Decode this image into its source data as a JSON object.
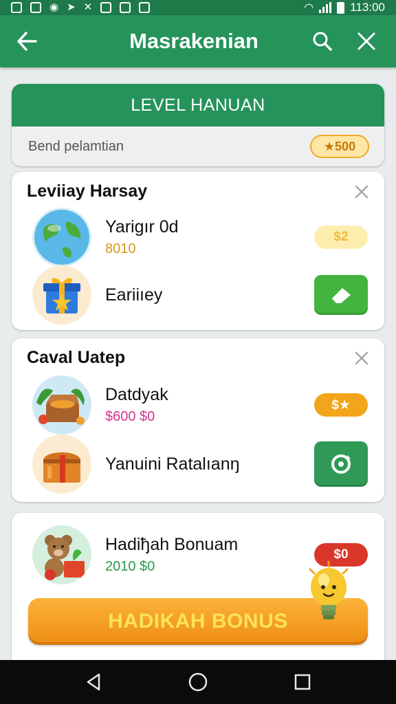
{
  "status_bar": {
    "time": "113:00"
  },
  "app_bar": {
    "title": "Masrakenian"
  },
  "level": {
    "header": "LEVEL HANUAN",
    "label": "Bend pelamtian",
    "points": "★500"
  },
  "cards": [
    {
      "title": "Leviiay Harsay",
      "rows": [
        {
          "name": "Yarigır 0d",
          "sub": "8010",
          "pill": "$2",
          "avatar": "globe-icon"
        },
        {
          "name": "Eariiıey",
          "sub": "",
          "avatar": "gift-box-icon",
          "button": "eraser-icon"
        }
      ]
    },
    {
      "title": "Caval Uatep",
      "rows": [
        {
          "name": "Datdyak",
          "sub": "$600 $0",
          "pill": "$★",
          "avatar": "treasure-chest-icon"
        },
        {
          "name": "Yanuini Ratalıanŋ",
          "sub": "",
          "avatar": "chest-icon",
          "button": "refresh-icon"
        }
      ]
    },
    {
      "title": "",
      "rows": [
        {
          "name": "Hadiђah Bonuam",
          "sub": "2010 $0",
          "pill": "$0",
          "avatar": "teddy-bear-icon"
        }
      ],
      "bonus_button": "HADIKAH  BONUS"
    }
  ],
  "colors": {
    "primary_green": "#25935a",
    "status_green": "#1f7a4a",
    "bonus_orange": "#f2a51a",
    "accent_red": "#d8372a"
  }
}
